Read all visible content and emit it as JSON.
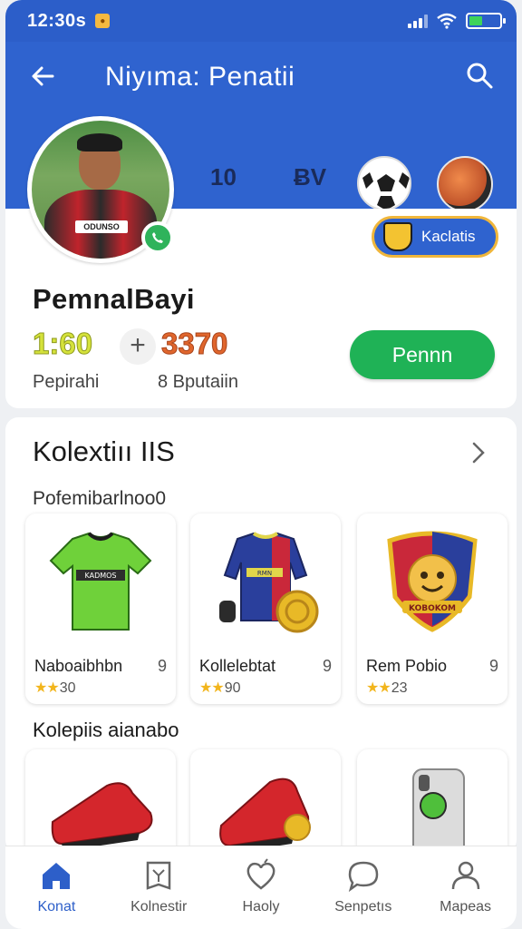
{
  "status_bar": {
    "time": "12:30s",
    "battery_level": 0.45
  },
  "header": {
    "title": "Niyıma: Penatii",
    "stat_a": "10",
    "stat_b": "ɃV"
  },
  "profile": {
    "player_name": "PemnalBayi",
    "score_left": "1:60",
    "plus": "+",
    "score_right": "3370",
    "sub_left": "Pepirahi",
    "sub_right": "8 Bputaiin",
    "primary_button": "Pennn",
    "club_chip": "Kaclatis",
    "shirt_text": "ODUNSO"
  },
  "collection": {
    "title": "Kolextiıı IIS",
    "subtitle": "Pofemibarlnoo0",
    "items": [
      {
        "name": "Naboaibhbn",
        "count": "9",
        "rating": "30",
        "badge_text": "KADMOS"
      },
      {
        "name": "Kollelebtat",
        "count": "9",
        "rating": "90",
        "badge_text": "RMN"
      },
      {
        "name": "Rem Pobio",
        "count": "9",
        "rating": "23",
        "badge_text": "KOBOKOM"
      }
    ],
    "stars": "★★",
    "section2_title": "Kolepiis aianabo"
  },
  "nav": [
    {
      "label": "Konat",
      "icon": "home-icon",
      "active": true
    },
    {
      "label": "Kolnestir",
      "icon": "collection-icon",
      "active": false
    },
    {
      "label": "Haoly",
      "icon": "heart-icon",
      "active": false
    },
    {
      "label": "Senpetıs",
      "icon": "chat-icon",
      "active": false
    },
    {
      "label": "Mapeas",
      "icon": "profile-icon",
      "active": false
    }
  ],
  "colors": {
    "primary": "#2f63cf",
    "accent_green": "#1fb256",
    "gold": "#f2b51c"
  }
}
